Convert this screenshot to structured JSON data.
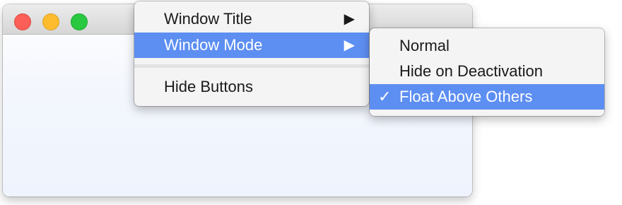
{
  "window": {
    "controls": {
      "close_color": "#fc5f57",
      "minimize_color": "#fdbc2e",
      "maximize_color": "#28c840"
    }
  },
  "context_menu": {
    "items": [
      {
        "label": "Window Title",
        "arrow": "▶",
        "highlighted": false
      },
      {
        "label": "Window Mode",
        "arrow": "▶",
        "highlighted": true
      },
      {
        "label": "Hide Buttons",
        "highlighted": false
      }
    ]
  },
  "submenu": {
    "items": [
      {
        "label": "Normal",
        "checked": false,
        "highlighted": false
      },
      {
        "label": "Hide on Deactivation",
        "checked": false,
        "highlighted": false
      },
      {
        "label": "Float Above Others",
        "checked": true,
        "check_glyph": "✓",
        "highlighted": true
      }
    ]
  },
  "colors": {
    "highlight": "#5d8ef2",
    "menu_background": "#f4f4f4"
  }
}
